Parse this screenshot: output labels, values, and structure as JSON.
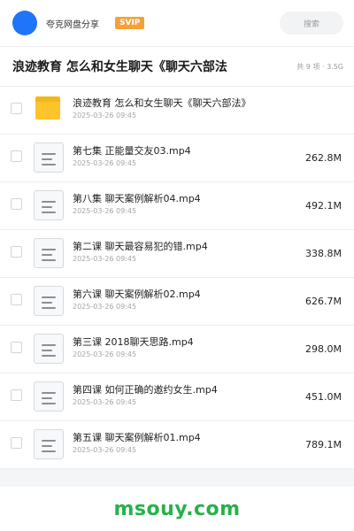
{
  "header": {
    "user_name": "夸克网盘分享",
    "badge": "SVIP",
    "search_placeholder": "搜索"
  },
  "folder": {
    "title": "浪迹教育 怎么和女生聊天《聊天六部法",
    "meta": "共 9 项 · 3.5G"
  },
  "files": [
    {
      "name": "浪迹教育 怎么和女生聊天《聊天六部法》",
      "date": "2025-03-26 09:45",
      "size": "",
      "type": "folder"
    },
    {
      "name": "第七集 正能量交友03.mp4",
      "date": "2025-03-26 09:45",
      "size": "262.8M",
      "type": "video"
    },
    {
      "name": "第八集 聊天案例解析04.mp4",
      "date": "2025-03-26 09:45",
      "size": "492.1M",
      "type": "video"
    },
    {
      "name": "第二课 聊天最容易犯的错.mp4",
      "date": "2025-03-26 09:45",
      "size": "338.8M",
      "type": "video"
    },
    {
      "name": "第六课 聊天案例解析02.mp4",
      "date": "2025-03-26 09:45",
      "size": "626.7M",
      "type": "video"
    },
    {
      "name": "第三课 2018聊天思路.mp4",
      "date": "2025-03-26 09:45",
      "size": "298.0M",
      "type": "video"
    },
    {
      "name": "第四课 如何正确的邀约女生.mp4",
      "date": "2025-03-26 09:45",
      "size": "451.0M",
      "type": "video"
    },
    {
      "name": "第五课 聊天案例解析01.mp4",
      "date": "2025-03-26 09:45",
      "size": "789.1M",
      "type": "video"
    }
  ],
  "watermark": "msouy.com",
  "colors": {
    "avatar": "#1f74f7",
    "svip_badge": "#f5a13a",
    "folder_icon": "#fdc42c",
    "watermark": "#27b14a"
  }
}
